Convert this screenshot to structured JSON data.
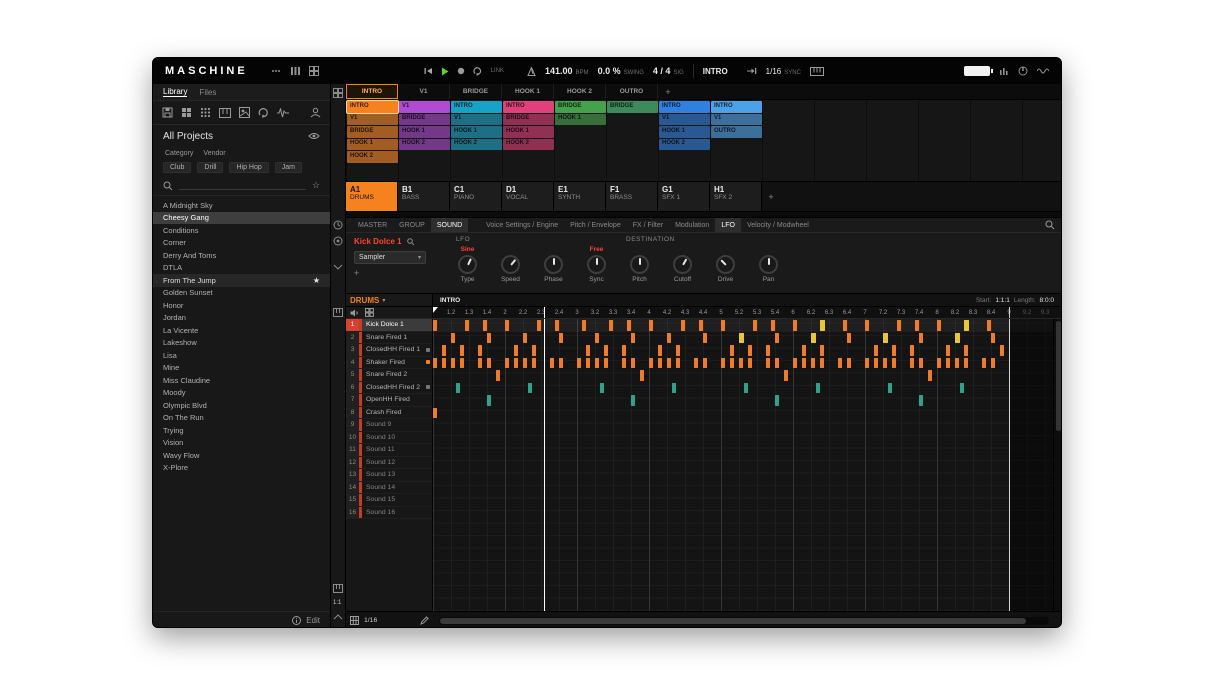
{
  "header": {
    "logo": "MASCHINE",
    "link_label": "LINK",
    "tempo": {
      "value": "141.00",
      "unit": "BPM"
    },
    "swing": {
      "value": "0.0 %",
      "unit": "SWING"
    },
    "sig": {
      "value": "4 / 4",
      "unit": "SIG"
    },
    "section": "INTRO",
    "grid": {
      "value": "1/16",
      "unit": "SYNC"
    }
  },
  "sidebar": {
    "tabs": [
      "Library",
      "Files"
    ],
    "active_tab": "Library",
    "title": "All Projects",
    "filters_row1": [
      "Category",
      "Vendor"
    ],
    "filters_row2": [
      "Club",
      "Drill",
      "Hip Hop",
      "Jam"
    ],
    "projects": [
      {
        "name": "A Midnight Sky"
      },
      {
        "name": "Cheesy Gang",
        "selected": true
      },
      {
        "name": "Conditions"
      },
      {
        "name": "Corner"
      },
      {
        "name": "Derry And Toms"
      },
      {
        "name": "DTLA"
      },
      {
        "name": "From The Jump",
        "starred": true
      },
      {
        "name": "Golden Sunset"
      },
      {
        "name": "Honor"
      },
      {
        "name": "Jordan"
      },
      {
        "name": "La Vicente"
      },
      {
        "name": "Lakeshow"
      },
      {
        "name": "Lisa"
      },
      {
        "name": "Mine"
      },
      {
        "name": "Miss Claudine"
      },
      {
        "name": "Moody"
      },
      {
        "name": "Olympic Blvd"
      },
      {
        "name": "On The Run"
      },
      {
        "name": "Trying"
      },
      {
        "name": "Vision"
      },
      {
        "name": "Wavy Flow"
      },
      {
        "name": "X-Plore"
      }
    ],
    "edit_label": "Edit"
  },
  "arranger": {
    "sections": [
      {
        "label": "INTRO",
        "active": true
      },
      {
        "label": "V1"
      },
      {
        "label": "BRIDGE"
      },
      {
        "label": "HOOK 1"
      },
      {
        "label": "HOOK 2"
      },
      {
        "label": "OUTRO"
      }
    ],
    "add_label": "+",
    "groups": [
      {
        "id": "A1",
        "name": "DRUMS",
        "color": "#f5821f",
        "selected": true,
        "clips": [
          {
            "label": "INTRO",
            "active": true
          },
          {
            "label": "V1"
          },
          {
            "label": "BRIDGE"
          },
          {
            "label": "HOOK 1"
          },
          {
            "label": "HOOK 2"
          }
        ]
      },
      {
        "id": "B1",
        "name": "BASS",
        "color": "#b04cd4",
        "clips": [
          {
            "label": "V1"
          },
          {
            "label": "BRIDGE"
          },
          {
            "label": "HOOK 1"
          },
          {
            "label": "HOOK 2"
          }
        ]
      },
      {
        "id": "C1",
        "name": "PIANO",
        "color": "#17a2c8",
        "clips": [
          {
            "label": "INTRO"
          },
          {
            "label": "V1"
          },
          {
            "label": "HOOK 1"
          },
          {
            "label": "HOOK 2"
          }
        ]
      },
      {
        "id": "D1",
        "name": "VOCAL",
        "color": "#e0417a",
        "clips": [
          {
            "label": "INTRO"
          },
          {
            "label": "BRIDGE"
          },
          {
            "label": "HOOK 1"
          },
          {
            "label": "HOOK 2"
          }
        ]
      },
      {
        "id": "E1",
        "name": "SYNTH",
        "color": "#44a24c",
        "clips": [
          {
            "label": "BRIDGE"
          },
          {
            "label": "HOOK 1"
          }
        ]
      },
      {
        "id": "F1",
        "name": "BRASS",
        "color": "#3d8a5c",
        "clips": [
          {
            "label": "BRIDGE"
          }
        ]
      },
      {
        "id": "G1",
        "name": "SFX 1",
        "color": "#2f80e0",
        "clips": [
          {
            "label": "INTRO"
          },
          {
            "label": "V1"
          },
          {
            "label": "HOOK 1"
          },
          {
            "label": "HOOK 2"
          }
        ]
      },
      {
        "id": "H1",
        "name": "SFX 2",
        "color": "#4ba2e8",
        "clips": [
          {
            "label": "INTRO"
          },
          {
            "label": "V1"
          },
          {
            "label": "OUTRO"
          }
        ]
      }
    ]
  },
  "channel": {
    "scope_tabs": [
      "MASTER",
      "GROUP",
      "SOUND"
    ],
    "active_scope": "SOUND",
    "sound_name": "Kick Dolce 1",
    "plugin": "Sampler",
    "add_label": "+",
    "param_tabs": [
      "Voice Settings / Engine",
      "Pitch / Envelope",
      "FX / Filter",
      "Modulation",
      "LFO",
      "Velocity / Modwheel"
    ],
    "active_param_tab": "LFO",
    "lfo_label": "LFO",
    "destination_label": "DESTINATION",
    "knobs": [
      {
        "value": "Sine",
        "label": "Type",
        "angle": 25
      },
      {
        "label": "Speed",
        "angle": 40
      },
      {
        "label": "Phase",
        "angle": 0
      },
      {
        "value": "Free",
        "label": "Sync",
        "angle": 0
      },
      {
        "label": "Pitch",
        "angle": 0,
        "dest": true
      },
      {
        "label": "Cutoff",
        "angle": 30,
        "dest": true
      },
      {
        "label": "Drive",
        "angle": -45,
        "dest": true
      },
      {
        "label": "Pan",
        "angle": 0,
        "dest": true
      }
    ]
  },
  "pattern": {
    "group_label": "DRUMS",
    "pattern_label": "INTRO",
    "start_label": "Start:",
    "start_value": "1:1:1",
    "length_label": "Length:",
    "length_value": "8:0:0",
    "grid_value": "1/16",
    "position_label": "1:1",
    "colors": {
      "main": "#ef7b2b",
      "alt": "#e8c832",
      "teal": "#2fa389"
    },
    "ruler": [
      "1.2",
      "1.3",
      "1.4",
      "2",
      "2.2",
      "2.3",
      "2.4",
      "3",
      "3.2",
      "3.3",
      "3.4",
      "4",
      "4.2",
      "4.3",
      "4.4",
      "5",
      "5.2",
      "5.3",
      "5.4",
      "6",
      "6.2",
      "6.3",
      "6.4",
      "7",
      "7.2",
      "7.3",
      "7.4",
      "8",
      "8.2",
      "8.3",
      "8.4",
      "9",
      "9.2",
      "9.3"
    ],
    "tracks": [
      {
        "num": "1",
        "name": "Kick Dolce 1",
        "selected": true,
        "notes": [
          0,
          7,
          11,
          16,
          23,
          27,
          33,
          39,
          43,
          48,
          55,
          59,
          64,
          71,
          75,
          80,
          [
            86,
            1
          ],
          91,
          96,
          103,
          107,
          112,
          [
            118,
            1
          ],
          123
        ]
      },
      {
        "num": "2",
        "name": "Snare Fired 1",
        "notes": [
          4,
          12,
          20,
          28,
          36,
          44,
          52,
          60,
          [
            68,
            1
          ],
          76,
          [
            84,
            1
          ],
          92,
          [
            100,
            1
          ],
          108,
          [
            116,
            1
          ],
          124
        ]
      },
      {
        "num": "3",
        "name": "ClosedHH Fired 1",
        "marker": "gray",
        "notes": [
          2,
          6,
          10,
          18,
          22,
          34,
          38,
          42,
          50,
          54,
          66,
          70,
          74,
          82,
          86,
          98,
          102,
          106,
          114,
          118,
          126
        ]
      },
      {
        "num": "4",
        "name": "Shaker Fired",
        "marker": "orange",
        "notes": [
          0,
          2,
          4,
          6,
          10,
          12,
          16,
          18,
          20,
          22,
          26,
          28,
          32,
          34,
          36,
          38,
          42,
          44,
          48,
          50,
          52,
          54,
          58,
          60,
          64,
          66,
          68,
          70,
          74,
          76,
          80,
          82,
          84,
          86,
          90,
          92,
          96,
          98,
          100,
          102,
          106,
          108,
          112,
          114,
          116,
          118,
          122,
          124
        ]
      },
      {
        "num": "5",
        "name": "Snare Fired 2",
        "notes": [
          14,
          46,
          78,
          110
        ]
      },
      {
        "num": "6",
        "name": "ClosedHH Fired 2",
        "marker": "gray",
        "color": "teal",
        "notes": [
          5,
          21,
          37,
          53,
          69,
          85,
          101,
          117
        ]
      },
      {
        "num": "7",
        "name": "OpenHH Fired",
        "color": "teal",
        "notes": [
          12,
          44,
          76,
          108
        ]
      },
      {
        "num": "8",
        "name": "Crash Fired",
        "notes": [
          0
        ]
      },
      {
        "num": "9",
        "name": "Sound 9",
        "soft": true,
        "notes": []
      },
      {
        "num": "10",
        "name": "Sound 10",
        "soft": true,
        "notes": []
      },
      {
        "num": "11",
        "name": "Sound 11",
        "soft": true,
        "notes": []
      },
      {
        "num": "12",
        "name": "Sound 12",
        "soft": true,
        "notes": []
      },
      {
        "num": "13",
        "name": "Sound 13",
        "soft": true,
        "notes": []
      },
      {
        "num": "14",
        "name": "Sound 14",
        "soft": true,
        "notes": []
      },
      {
        "num": "15",
        "name": "Sound 15",
        "soft": true,
        "notes": []
      },
      {
        "num": "16",
        "name": "Sound 16",
        "soft": true,
        "notes": []
      }
    ]
  }
}
